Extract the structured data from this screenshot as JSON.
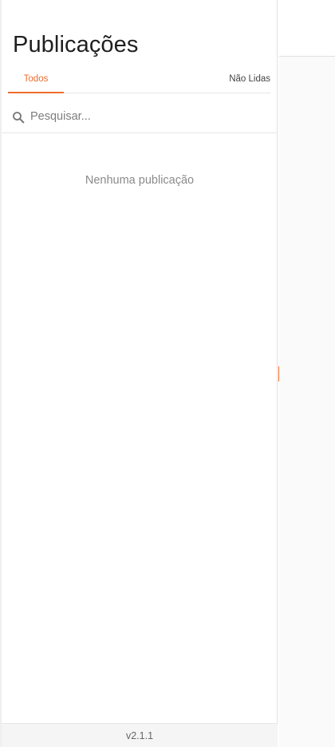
{
  "header": {
    "title": "Publicações"
  },
  "tabs": {
    "all_label": "Todos",
    "unread_label": "Não Lidas"
  },
  "search": {
    "placeholder": "Pesquisar...",
    "value": "",
    "icon": "search-icon"
  },
  "empty_state": {
    "message": "Nenhuma publicação"
  },
  "footer": {
    "version": "v2.1.1"
  },
  "colors": {
    "accent": "#ef6c2e",
    "text": "#1f1f1f",
    "muted": "#8a8a8a",
    "footer_bg": "#f5f5f5",
    "main_bg": "#fafafa"
  }
}
